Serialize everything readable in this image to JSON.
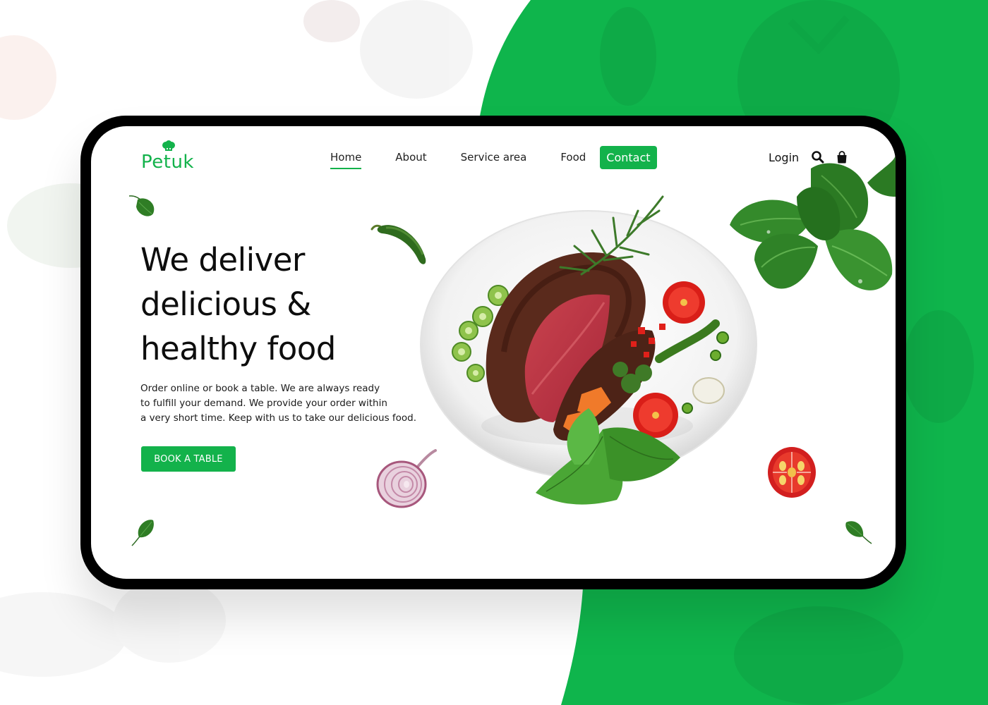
{
  "brand": {
    "name": "Petuk",
    "color": "#13b24b"
  },
  "nav": {
    "items": [
      "Home",
      "About",
      "Service area",
      "Food"
    ],
    "active": "Home",
    "contact_label": "Contact"
  },
  "header": {
    "login_label": "Login",
    "icons": [
      "search-icon",
      "shopping-bag-icon"
    ]
  },
  "hero": {
    "title_lines": [
      "We deliver",
      "delicious &",
      "healthy food"
    ],
    "description_lines": [
      "Order online or book a table. We are always ready",
      "to fulfill your demand. We provide your order within",
      "a very short time. Keep with us to take our delicious food."
    ],
    "cta_label": "BOOK A TABLE"
  },
  "colors": {
    "backdrop_green": "#0fb54c",
    "frame": "#000000",
    "text": "#0d0d0d"
  }
}
